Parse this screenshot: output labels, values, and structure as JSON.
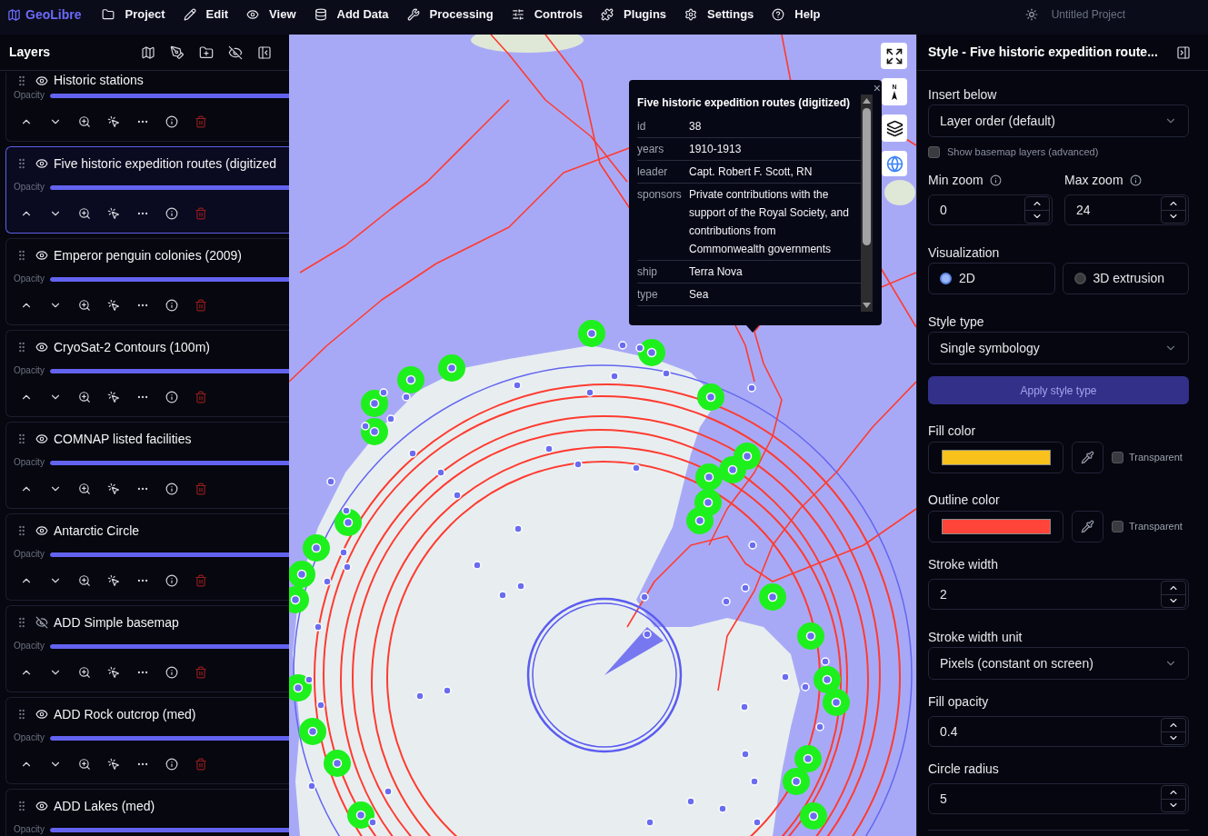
{
  "app": {
    "name": "GeoLibre"
  },
  "menu": [
    "Project",
    "Edit",
    "View",
    "Add Data",
    "Processing",
    "Controls",
    "Plugins",
    "Settings",
    "Help"
  ],
  "project_title": "Untitled Project",
  "layers_panel": {
    "title": "Layers",
    "layers": [
      {
        "name": "Historic stations",
        "visible": true,
        "selected": false,
        "opacity_label": "Opacity",
        "level": 1
      },
      {
        "name": "Five historic expedition routes (digitized",
        "visible": true,
        "selected": true,
        "opacity_label": "Opacity",
        "level": 1
      },
      {
        "name": "Emperor penguin colonies (2009)",
        "visible": true,
        "selected": false,
        "opacity_label": "Opacity",
        "level": 1
      },
      {
        "name": "CryoSat-2 Contours (100m)",
        "visible": true,
        "selected": false,
        "opacity_label": "Opacity",
        "level": 1
      },
      {
        "name": "COMNAP listed facilities",
        "visible": true,
        "selected": false,
        "opacity_label": "Opacity",
        "level": 1
      },
      {
        "name": "Antarctic Circle",
        "visible": true,
        "selected": false,
        "opacity_label": "Opacity",
        "level": 1
      },
      {
        "name": "ADD Simple basemap",
        "visible": false,
        "selected": false,
        "opacity_label": "Opacity",
        "level": 1
      },
      {
        "name": "ADD Rock outcrop (med)",
        "visible": true,
        "selected": false,
        "opacity_label": "Opacity",
        "level": 1
      },
      {
        "name": "ADD Lakes (med)",
        "visible": true,
        "selected": false,
        "opacity_label": "Opacity",
        "level": 1
      }
    ]
  },
  "map": {
    "compass_label": "N",
    "popup": {
      "title": "Five historic expedition routes (digitized)",
      "close": "×",
      "rows": [
        {
          "key": "id",
          "value": "38"
        },
        {
          "key": "years",
          "value": "1910-1913"
        },
        {
          "key": "leader",
          "value": "Capt. Robert F. Scott, RN"
        },
        {
          "key": "sponsors",
          "value": "Private contributions with the support of the Royal Society, and contributions from Commonwealth governments"
        },
        {
          "key": "ship",
          "value": "Terra Nova"
        },
        {
          "key": "type",
          "value": "Sea"
        }
      ]
    }
  },
  "style_panel": {
    "title": "Style - Five historic expedition route...",
    "fields": [
      {
        "kind": "select",
        "label": "Insert below",
        "value": "Layer order (default)"
      },
      {
        "kind": "checkbox",
        "label": "Show basemap layers (advanced)",
        "checked": false
      },
      {
        "kind": "number_pair",
        "items": [
          {
            "label": "Min zoom",
            "value": "0"
          },
          {
            "label": "Max zoom",
            "value": "24"
          }
        ]
      },
      {
        "kind": "radio",
        "label": "Visualization",
        "options": [
          {
            "label": "2D",
            "selected": true
          },
          {
            "label": "3D extrusion",
            "selected": false
          }
        ]
      },
      {
        "kind": "select",
        "label": "Style type",
        "value": "Single symbology"
      },
      {
        "kind": "button",
        "label": "Apply style type",
        "disabled": true
      },
      {
        "kind": "color",
        "label": "Fill color",
        "color": "#f8c11b",
        "transparent_label": "Transparent",
        "transparent": false
      },
      {
        "kind": "color",
        "label": "Outline color",
        "color": "#ff453a",
        "transparent_label": "Transparent",
        "transparent": false
      },
      {
        "kind": "number",
        "label": "Stroke width",
        "value": "2"
      },
      {
        "kind": "select",
        "label": "Stroke width unit",
        "value": "Pixels (constant on screen)"
      },
      {
        "kind": "number",
        "label": "Fill opacity",
        "value": "0.4"
      },
      {
        "kind": "number",
        "label": "Circle radius",
        "value": "5"
      }
    ]
  }
}
